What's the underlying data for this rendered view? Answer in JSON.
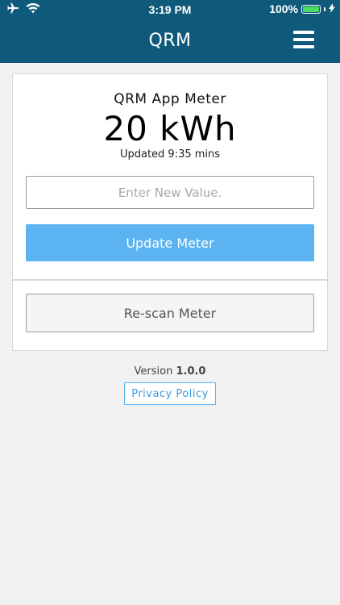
{
  "status_bar": {
    "time": "3:19 PM",
    "battery_percent": "100%",
    "battery_level": 1.0,
    "battery_color": "#4cd964"
  },
  "header": {
    "title": "QRM",
    "background_color": "#0f5a7a",
    "menu_icon": "hamburger-icon"
  },
  "meter": {
    "label": "QRM App Meter",
    "value": "20 kWh",
    "updated": "Updated 9:35 mins",
    "input_placeholder": "Enter New Value.",
    "input_value": "",
    "update_button": "Update Meter",
    "update_button_color": "#5cb3f2"
  },
  "rescan": {
    "button_label": "Re-scan Meter"
  },
  "footer": {
    "version_label": "Version",
    "version_number": "1.0.0",
    "privacy_label": "Privacy Policy"
  }
}
